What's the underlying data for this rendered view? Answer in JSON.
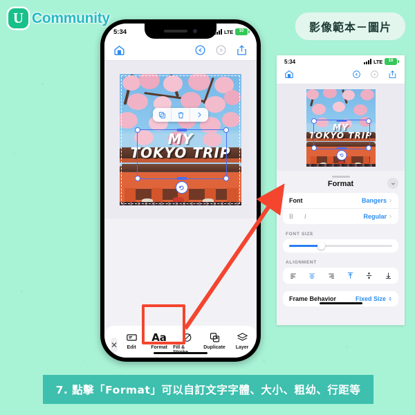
{
  "page": {
    "background_color": "#a8f2d6",
    "accent_color": "#3fbfae"
  },
  "logo": {
    "mark": "U",
    "text": "Community"
  },
  "badge": {
    "label": "影像範本－圖片"
  },
  "caption": {
    "text": "7. 點擊「Format」可以自訂文字字體、大小、粗幼、行距等"
  },
  "phone": {
    "status_bar": {
      "time": "5:34",
      "network": "LTE",
      "battery": "10",
      "signal_icon": "signal-bars-icon"
    },
    "app_toolbar": {
      "home_icon": "home-icon",
      "undo_icon": "undo-icon",
      "redo_icon": "redo-icon",
      "share_icon": "share-icon"
    },
    "canvas": {
      "text_line1": "MY",
      "text_line2": "TOKYO TRIP",
      "float_toolbar": [
        "duplicate-icon",
        "trash-icon",
        "chevron-right-icon"
      ]
    },
    "bottom_toolbar": {
      "close_label": "✕",
      "items": [
        {
          "label": "Edit",
          "icon": "edit-icon"
        },
        {
          "label": "Format",
          "icon": "aa-icon",
          "glyph": "Aa",
          "highlighted": true
        },
        {
          "label": "Fill & Stroke",
          "icon": "fill-stroke-icon"
        },
        {
          "label": "Duplicate",
          "icon": "duplicate-icon"
        },
        {
          "label": "Layer",
          "icon": "layer-icon"
        }
      ]
    }
  },
  "zoom_panel": {
    "status_bar": {
      "time": "5:34",
      "network": "LTE",
      "battery": "10"
    },
    "canvas": {
      "text_line1": "MY",
      "text_line2": "TOKYO TRIP"
    },
    "sheet": {
      "title": "Format",
      "collapse_icon": "chevron-down-icon",
      "font_row": {
        "label": "Font",
        "value": "Bangers"
      },
      "style_row": {
        "bold": "B",
        "italic": "I",
        "value": "Regular"
      },
      "font_size": {
        "label": "FONT SIZE",
        "percent": 31
      },
      "alignment": {
        "label": "ALIGNMENT",
        "options": [
          "align-left-icon",
          "align-center-icon",
          "align-right-icon",
          "align-top-icon",
          "align-middle-icon",
          "align-bottom-icon"
        ],
        "selected_index": 1
      },
      "frame_behavior": {
        "label": "Frame Behavior",
        "value": "Fixed Size"
      }
    }
  }
}
